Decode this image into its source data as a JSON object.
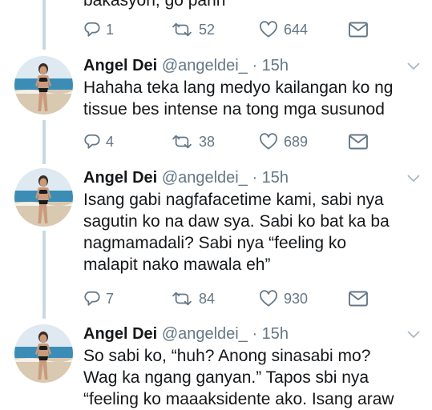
{
  "top_fragment": "bakasyon, go parin",
  "top_actions": {
    "reply_count": "1",
    "retweet_count": "52",
    "like_count": "644"
  },
  "tweets": [
    {
      "name": "Angel Dei",
      "handle": "@angeldei_",
      "time": "· 15h",
      "lines": [
        "Hahaha teka lang medyo kailangan ko ng",
        "tissue bes intense na tong mga susunod"
      ],
      "reply_count": "4",
      "retweet_count": "38",
      "like_count": "689"
    },
    {
      "name": "Angel Dei",
      "handle": "@angeldei_",
      "time": "· 15h",
      "lines": [
        "Isang gabi nagfafacetime kami, sabi nya",
        "sagutin ko na daw sya. Sabi ko bat ka ba",
        "nagmamadali? Sabi nya “feeling ko",
        "malapit nako mawala eh”"
      ],
      "reply_count": "7",
      "retweet_count": "84",
      "like_count": "930"
    },
    {
      "name": "Angel Dei",
      "handle": "@angeldei_",
      "time": "· 15h",
      "lines": [
        "So sabi ko, “huh? Anong sinasabi mo?",
        "Wag ka ngang ganyan.” Tapos sbi nya",
        "“feeling ko maaaksidente ako. Isang araw"
      ]
    }
  ],
  "icons": {
    "reply": "reply-icon",
    "retweet": "retweet-icon",
    "like": "heart-icon",
    "dm": "envelope-icon",
    "menu": "chevron-down-icon"
  },
  "colors": {
    "text": "#14171a",
    "secondary": "#657786",
    "thread_line": "#c9d9e4"
  }
}
